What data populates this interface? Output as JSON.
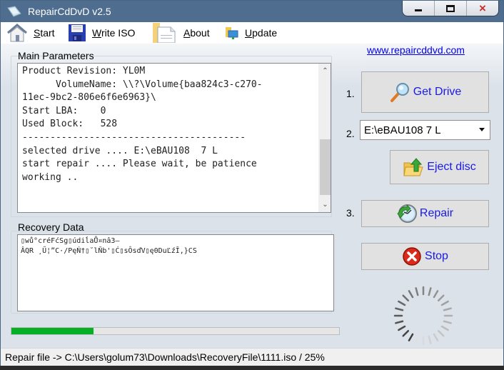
{
  "window": {
    "title": "RepairCdDvD v2.5",
    "controls": {
      "minimize": "minimize",
      "maximize": "maximize",
      "close": "×"
    }
  },
  "toolbar": {
    "items": [
      {
        "label": "Start",
        "icon": "home-icon"
      },
      {
        "label": "Write ISO",
        "icon": "floppy-disk-icon"
      },
      {
        "label": "About",
        "icon": "document-icon"
      },
      {
        "label": "Update",
        "icon": "network-folder-icon"
      }
    ]
  },
  "website_link": "www.repaircddvd.com",
  "main_parameters": {
    "label": "Main Parameters",
    "log_lines": [
      "Product Revision: YL0M",
      "      VolumeName: \\\\?\\Volume{baa824c3-c270-",
      "11ec-9bc2-806e6f6e6963}\\",
      "Start LBA:    0",
      "Used Block:   528",
      "----------------------------------------",
      "selected drive .... E:\\eBAU108  7 L",
      "start repair .... Please wait, be patience",
      "working .."
    ]
  },
  "recovery_data": {
    "label": "Recovery Data",
    "lines": [
      "▯wů°créFćSg▯údiĺaŮ¤nâ3—",
      "ÂQR ¸Ű¦”C·/PęŃ†▯˘lŇb'▯Ć▯sÔsďV▯ę0DuĽźĪ,}CS"
    ]
  },
  "steps": {
    "step1": "1.",
    "step2": "2.",
    "step3": "3."
  },
  "buttons": {
    "get_drive": "Get Drive",
    "eject_disc": "Eject disc",
    "repair": "Repair",
    "stop": "Stop"
  },
  "drive_select": {
    "selected": "E:\\eBAU108  7 L"
  },
  "progress": {
    "percent": 25,
    "color": "#06b025"
  },
  "status_bar": {
    "text": "Repair file -> C:\\Users\\golum73\\Downloads\\RecoveryFile\\1111.iso  /  25%"
  },
  "colors": {
    "titlebar": "#4f6d8f",
    "button_text": "#1a1ae6",
    "link": "#0000ee",
    "progress_fill": "#06b025"
  }
}
